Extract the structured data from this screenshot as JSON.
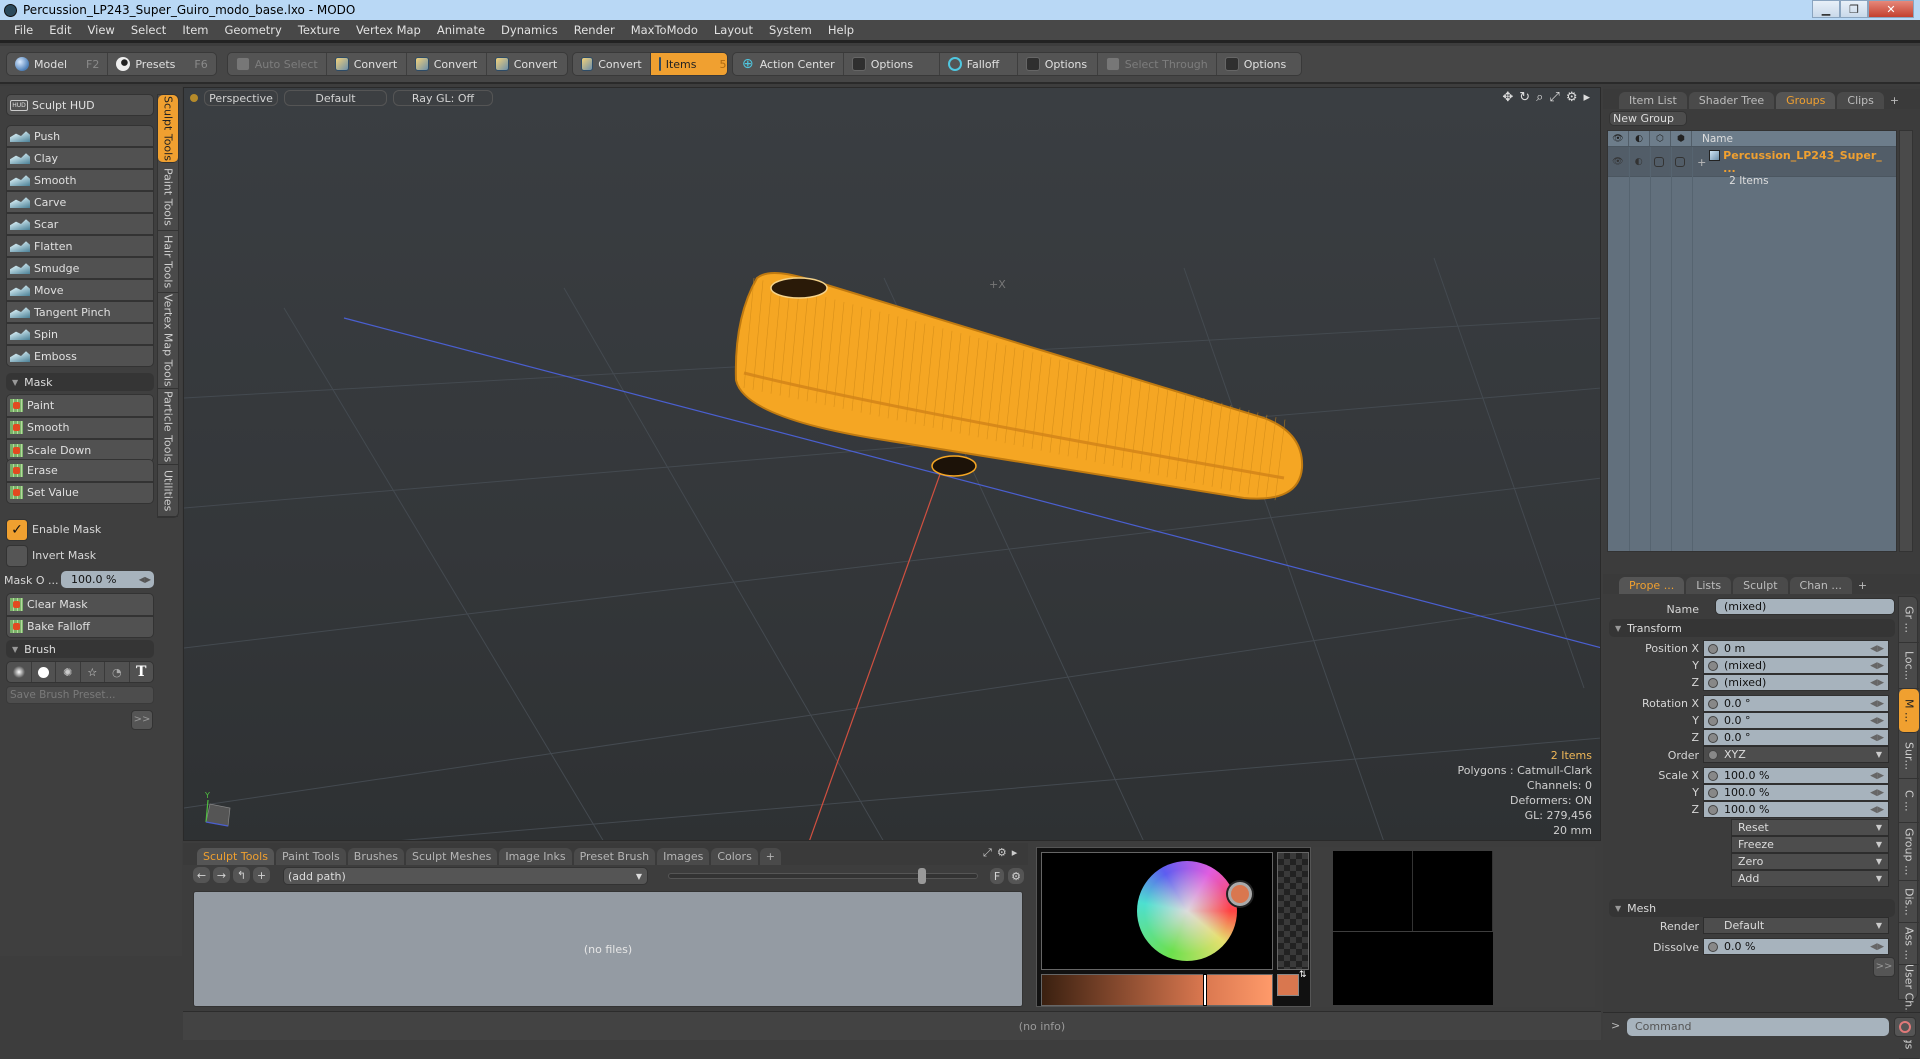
{
  "window": {
    "title": "Percussion_LP243_Super_Guiro_modo_base.lxo - MODO",
    "controls": [
      "minimize",
      "restore",
      "close"
    ]
  },
  "menu": [
    "File",
    "Edit",
    "View",
    "Select",
    "Item",
    "Geometry",
    "Texture",
    "Vertex Map",
    "Animate",
    "Dynamics",
    "Render",
    "MaxToModo",
    "Layout",
    "System",
    "Help"
  ],
  "toolbar": {
    "mode": [
      {
        "label": "Model",
        "key": "F2",
        "icon": "model-sphere-icon"
      },
      {
        "label": "Presets",
        "key": "F6",
        "icon": "presets-icon"
      }
    ],
    "selection": [
      {
        "label": "Auto Select",
        "disabled": true,
        "icon": "auto-select-icon"
      },
      {
        "label": "Convert",
        "icon": "convert-vertices-icon"
      },
      {
        "label": "Convert",
        "icon": "convert-edges-icon"
      },
      {
        "label": "Convert",
        "icon": "convert-polygons-icon"
      }
    ],
    "items": [
      {
        "label": "Convert",
        "icon": "convert-items-icon"
      },
      {
        "label": "Items",
        "key": "5",
        "active": true,
        "icon": "items-icon"
      }
    ],
    "action": [
      {
        "label": "Action Center",
        "icon": "action-center-icon"
      },
      {
        "label": "Options",
        "icon": "options-icon"
      }
    ],
    "falloff": [
      {
        "label": "Falloff",
        "icon": "falloff-icon"
      },
      {
        "label": "Options",
        "icon": "options-icon"
      }
    ],
    "select_through": [
      {
        "label": "Select Through",
        "disabled": true,
        "icon": "select-through-icon"
      },
      {
        "label": "Options",
        "icon": "options-icon"
      }
    ]
  },
  "left_panel": {
    "hud_label": "Sculpt HUD",
    "sculpt_tools": [
      "Push",
      "Clay",
      "Smooth",
      "Carve",
      "Scar",
      "Flatten",
      "Smudge",
      "Move",
      "Tangent Pinch",
      "Spin",
      "Emboss"
    ],
    "mask_section": "Mask",
    "mask_tools_a": [
      "Paint",
      "Smooth",
      "Scale Down"
    ],
    "mask_tools_b": [
      "Erase",
      "Set Value"
    ],
    "enable_mask": {
      "label": "Enable Mask",
      "checked": true
    },
    "invert_mask": {
      "label": "Invert Mask",
      "checked": false
    },
    "mask_opacity": {
      "label": "Mask O ...",
      "value": "100.0 %"
    },
    "mask_actions": [
      "Clear Mask",
      "Bake Falloff"
    ],
    "brush_section": "Brush",
    "brush_shapes": [
      "soft-brush-icon",
      "hard-brush-icon",
      "procedural-brush-icon",
      "star-brush-icon",
      "angle-brush-icon",
      "text-brush-icon"
    ],
    "brush_text_glyph": "T",
    "save_brush_placeholder": "Save Brush Preset...",
    "more_label": ">>",
    "vertical_tabs": [
      {
        "label": "Sculpt Tools",
        "active": true
      },
      {
        "label": "Paint Tools"
      },
      {
        "label": "Hair Tools"
      },
      {
        "label": "Vertex Map Tools"
      },
      {
        "label": "Particle Tools"
      },
      {
        "label": "Utilities"
      }
    ]
  },
  "viewport": {
    "view": "Perspective",
    "style": "Default",
    "raygl": "Ray GL: Off",
    "axis_label": "+X",
    "stats": {
      "items": "2 Items",
      "polygons": "Polygons : Catmull-Clark",
      "channels": "Channels: 0",
      "deformers": "Deformers: ON",
      "gl": "GL: 279,456",
      "scale": "20 mm"
    },
    "colors": {
      "mesh": "#f5a623",
      "wire": "#c07a10",
      "x_axis": "#d05040",
      "z_axis": "#4a5fd0"
    }
  },
  "groups_panel": {
    "tabs": [
      {
        "label": "Item List"
      },
      {
        "label": "Shader Tree"
      },
      {
        "label": "Groups",
        "active": true
      },
      {
        "label": "Clips"
      }
    ],
    "new_group_label": "New Group",
    "name_header": "Name",
    "rows": [
      {
        "name": "Percussion_LP243_Super_ ...",
        "sub": "2 Items"
      }
    ]
  },
  "properties_panel": {
    "tabs": [
      {
        "label": "Prope ...",
        "active": true
      },
      {
        "label": "Lists"
      },
      {
        "label": "Sculpt"
      },
      {
        "label": "Chan ..."
      }
    ],
    "name_label": "Name",
    "name_value": "(mixed)",
    "transform_section": "Transform",
    "position": {
      "label": "Position X",
      "x": "0 m",
      "y": "(mixed)",
      "z": "(mixed)"
    },
    "rotation": {
      "label": "Rotation X",
      "x": "0.0 °",
      "y": "0.0 °",
      "z": "0.0 °"
    },
    "order": {
      "label": "Order",
      "value": "XYZ"
    },
    "scale": {
      "label": "Scale X",
      "x": "100.0 %",
      "y": "100.0 %",
      "z": "100.0 %"
    },
    "axis_labels": {
      "y": "Y",
      "z": "Z"
    },
    "transform_actions": [
      "Reset",
      "Freeze",
      "Zero",
      "Add"
    ],
    "mesh_section": "Mesh",
    "render": {
      "label": "Render",
      "value": "Default"
    },
    "dissolve": {
      "label": "Dissolve",
      "value": "0.0 %"
    },
    "more_label": ">>",
    "vertical_tabs": [
      {
        "label": "Gr ..."
      },
      {
        "label": "Loc..."
      },
      {
        "label": "M ...",
        "active": true
      },
      {
        "label": "Sur..."
      },
      {
        "label": "C ..."
      },
      {
        "label": "Group ..."
      },
      {
        "label": "Dis..."
      },
      {
        "label": "Ass ..."
      },
      {
        "label": "User Ch..."
      },
      {
        "label": "Tags"
      }
    ]
  },
  "bottom_panel": {
    "tabs": [
      {
        "label": "Sculpt Tools",
        "active": true
      },
      {
        "label": "Paint Tools"
      },
      {
        "label": "Brushes"
      },
      {
        "label": "Sculpt Meshes"
      },
      {
        "label": "Image Inks"
      },
      {
        "label": "Preset Brush"
      },
      {
        "label": "Images"
      },
      {
        "label": "Colors"
      }
    ],
    "path_placeholder": "(add path)",
    "filter_label": "F",
    "empty_text": "(no files)",
    "thumbnail_size": 0.83
  },
  "color_picker": {
    "current_color": "#d9774f",
    "secondary_color": "#f5e000",
    "value_slider": 0.7
  },
  "status": {
    "info": "(no info)",
    "command_placeholder": "Command"
  }
}
